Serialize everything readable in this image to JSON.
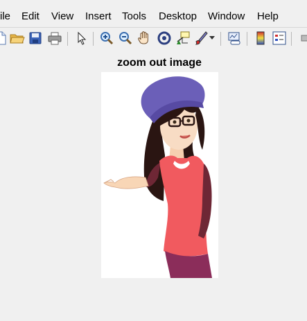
{
  "menu": {
    "items": [
      "ile",
      "Edit",
      "View",
      "Insert",
      "Tools",
      "Desktop",
      "Window",
      "Help"
    ]
  },
  "toolbar": {
    "icons": [
      "new-file-icon",
      "open-folder-icon",
      "save-icon",
      "print-icon",
      "pointer-icon",
      "zoom-in-icon",
      "zoom-out-icon",
      "pan-hand-icon",
      "rotate-3d-icon",
      "data-cursor-icon",
      "brush-icon",
      "link-plot-icon",
      "colorbar-icon",
      "legend-icon",
      "hide-tools-icon"
    ]
  },
  "figure": {
    "title": "zoom out image"
  },
  "colors": {
    "background": "#f0f0f0",
    "hat": "#6b5fb8",
    "top": "#f15a5f",
    "pants": "#8b2d5a",
    "hair": "#2a1512"
  }
}
